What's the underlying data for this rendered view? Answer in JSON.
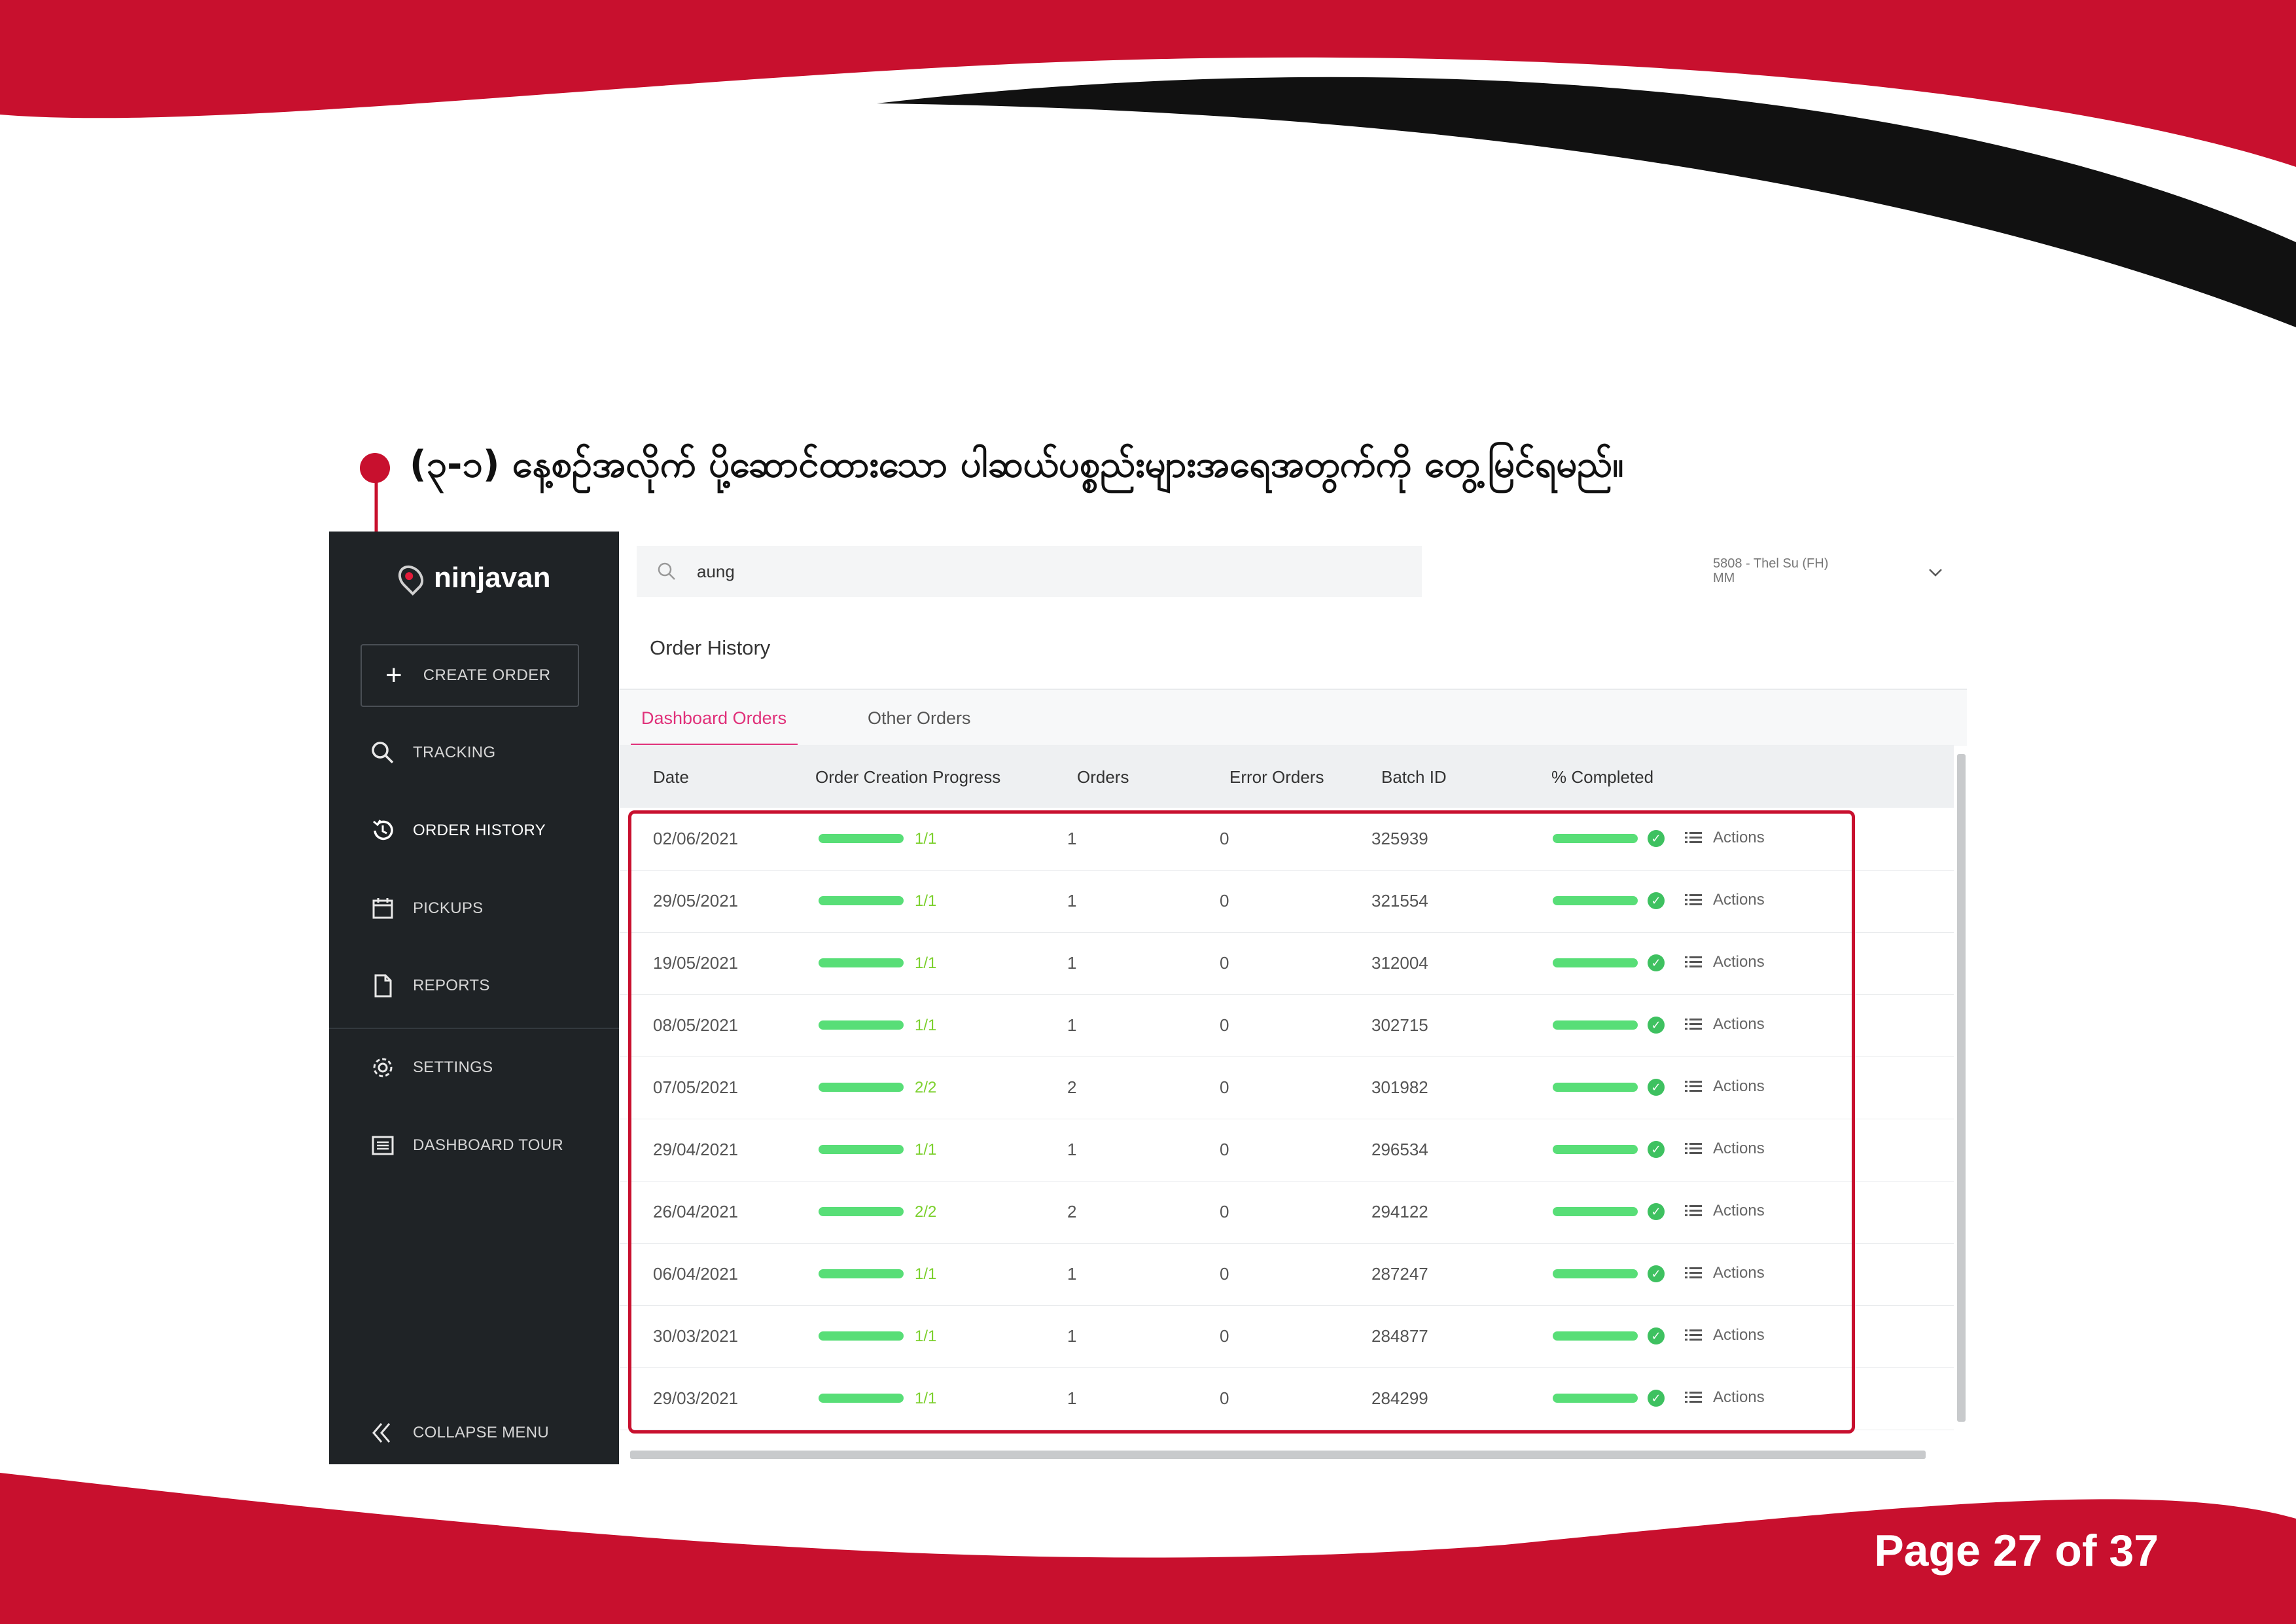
{
  "heading": "(၃-၁) နေ့စဉ်အလိုက် ပို့ဆောင်ထားသော ပါဆယ်ပစ္စည်းများအရေအတွက်ကို တွေ့မြင်ရမည်။",
  "page_number": "Page 27 of 37",
  "colors": {
    "brand_red": "#c8102e",
    "sidebar_bg": "#1f2326",
    "tab_active": "#e0317a",
    "progress": "#58de77"
  },
  "sidebar": {
    "logo": "ninjavan",
    "create_order": "CREATE ORDER",
    "items": [
      {
        "label": "TRACKING",
        "icon": "search-icon"
      },
      {
        "label": "ORDER HISTORY",
        "icon": "history-icon"
      },
      {
        "label": "PICKUPS",
        "icon": "calendar-icon"
      },
      {
        "label": "REPORTS",
        "icon": "document-icon"
      },
      {
        "label": "SETTINGS",
        "icon": "gear-icon"
      },
      {
        "label": "DASHBOARD TOUR",
        "icon": "list-icon"
      }
    ],
    "collapse": "COLLAPSE MENU"
  },
  "search": {
    "value": "aung"
  },
  "account": {
    "line1": "5808 - Thel Su (FH)",
    "line2": "MM"
  },
  "page_title": "Order History",
  "tabs": [
    "Dashboard Orders",
    "Other Orders"
  ],
  "table": {
    "headers": [
      "Date",
      "Order Creation Progress",
      "Orders",
      "Error Orders",
      "Batch ID",
      "% Completed"
    ],
    "actions_label": "Actions",
    "rows": [
      {
        "date": "02/06/2021",
        "progress": "1/1",
        "orders": "1",
        "errors": "0",
        "batch": "325939",
        "completed": 1.0
      },
      {
        "date": "29/05/2021",
        "progress": "1/1",
        "orders": "1",
        "errors": "0",
        "batch": "321554",
        "completed": 1.0
      },
      {
        "date": "19/05/2021",
        "progress": "1/1",
        "orders": "1",
        "errors": "0",
        "batch": "312004",
        "completed": 1.0
      },
      {
        "date": "08/05/2021",
        "progress": "1/1",
        "orders": "1",
        "errors": "0",
        "batch": "302715",
        "completed": 1.0
      },
      {
        "date": "07/05/2021",
        "progress": "2/2",
        "orders": "2",
        "errors": "0",
        "batch": "301982",
        "completed": 1.0
      },
      {
        "date": "29/04/2021",
        "progress": "1/1",
        "orders": "1",
        "errors": "0",
        "batch": "296534",
        "completed": 1.0
      },
      {
        "date": "26/04/2021",
        "progress": "2/2",
        "orders": "2",
        "errors": "0",
        "batch": "294122",
        "completed": 1.0
      },
      {
        "date": "06/04/2021",
        "progress": "1/1",
        "orders": "1",
        "errors": "0",
        "batch": "287247",
        "completed": 1.0
      },
      {
        "date": "30/03/2021",
        "progress": "1/1",
        "orders": "1",
        "errors": "0",
        "batch": "284877",
        "completed": 1.0
      },
      {
        "date": "29/03/2021",
        "progress": "1/1",
        "orders": "1",
        "errors": "0",
        "batch": "284299",
        "completed": 1.0
      }
    ]
  }
}
